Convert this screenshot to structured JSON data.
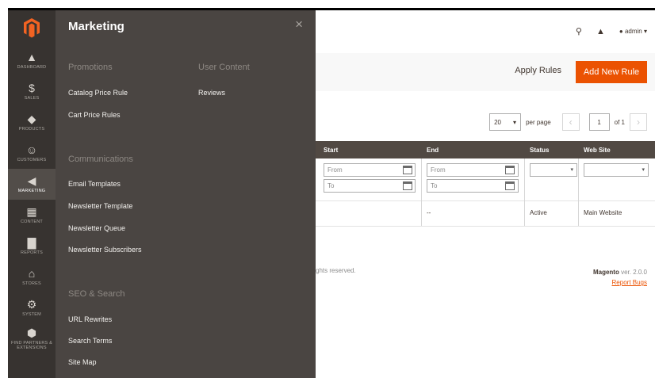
{
  "rail": {
    "items": [
      {
        "label": "DASHBOARD",
        "icon": "dashboard-icon",
        "glyph": "▲"
      },
      {
        "label": "SALES",
        "icon": "dollar-icon",
        "glyph": "$"
      },
      {
        "label": "PRODUCTS",
        "icon": "cube-icon",
        "glyph": "◆"
      },
      {
        "label": "CUSTOMERS",
        "icon": "person-icon",
        "glyph": "☺"
      },
      {
        "label": "MARKETING",
        "icon": "megaphone-icon",
        "glyph": "◀"
      },
      {
        "label": "CONTENT",
        "icon": "content-icon",
        "glyph": "▦"
      },
      {
        "label": "REPORTS",
        "icon": "bar-chart-icon",
        "glyph": "▇"
      },
      {
        "label": "STORES",
        "icon": "store-icon",
        "glyph": "⌂"
      },
      {
        "label": "SYSTEM",
        "icon": "gear-icon",
        "glyph": "⚙"
      },
      {
        "label": "FIND PARTNERS & EXTENSIONS",
        "icon": "extensions-icon",
        "glyph": "⬢"
      }
    ]
  },
  "flyout": {
    "title": "Marketing",
    "close_glyph": "×",
    "sections": {
      "promotions": {
        "title": "Promotions",
        "links": [
          "Catalog Price Rule",
          "Cart Price Rules"
        ]
      },
      "user_content": {
        "title": "User Content",
        "links": [
          "Reviews"
        ]
      },
      "communications": {
        "title": "Communications",
        "links": [
          "Email Templates",
          "Newsletter Template",
          "Newsletter Queue",
          "Newsletter Subscribers"
        ]
      },
      "seo": {
        "title": "SEO & Search",
        "links": [
          "URL Rewrites",
          "Search Terms",
          "Site Map"
        ]
      }
    }
  },
  "header": {
    "user": "admin"
  },
  "actions": {
    "apply": "Apply Rules",
    "add": "Add New Rule"
  },
  "pager": {
    "per_page_value": "20",
    "per_page_label": "per page",
    "page": "1",
    "of": "of 1"
  },
  "grid": {
    "headers": {
      "start": "Start",
      "end": "End",
      "status": "Status",
      "website": "Web Site"
    },
    "filters": {
      "from": "From",
      "to": "To"
    },
    "row": {
      "end": "--",
      "status": "Active",
      "website": "Main Website"
    }
  },
  "footer": {
    "copyright": "ghts reserved.",
    "brand": "Magento",
    "version": "ver. 2.0.0",
    "report": "Report Bugs"
  },
  "colors": {
    "accent": "#eb5202",
    "rail": "#373330",
    "flyout": "#4a4542",
    "grid_header": "#514943"
  }
}
